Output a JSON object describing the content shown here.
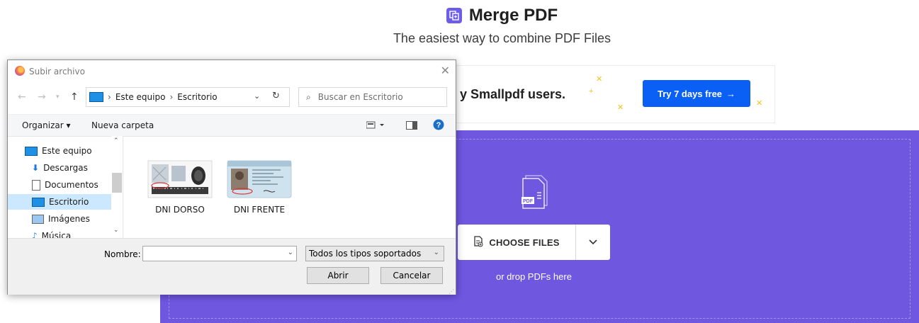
{
  "page": {
    "title": "Merge PDF",
    "subtitle": "The easiest way to combine PDF Files",
    "promo_text": "y Smallpdf users.",
    "try_button": "Try 7 days free",
    "choose_files": "CHOOSE FILES",
    "drop_hint": "or drop PDFs here",
    "pdf_badge": "PDF"
  },
  "dialog": {
    "title": "Subir archivo",
    "breadcrumb": [
      "Este equipo",
      "Escritorio"
    ],
    "search_placeholder": "Buscar en Escritorio",
    "toolbar": {
      "organize": "Organizar",
      "new_folder": "Nueva carpeta"
    },
    "nav_items": [
      {
        "label": "Este equipo",
        "icon": "computer-icon"
      },
      {
        "label": "Descargas",
        "icon": "download-icon"
      },
      {
        "label": "Documentos",
        "icon": "document-icon"
      },
      {
        "label": "Escritorio",
        "icon": "desktop-icon",
        "selected": true
      },
      {
        "label": "Imágenes",
        "icon": "pictures-icon"
      },
      {
        "label": "Música",
        "icon": "music-icon"
      }
    ],
    "files": [
      {
        "name": "DNI DORSO"
      },
      {
        "name": "DNI FRENTE"
      }
    ],
    "name_label": "Nombre:",
    "name_value": "",
    "file_types": "Todos los tipos soportados",
    "open_button": "Abrir",
    "cancel_button": "Cancelar"
  },
  "colors": {
    "brand_purple": "#6f57e0",
    "try_blue": "#0a5ff5",
    "selection": "#cce8ff"
  }
}
